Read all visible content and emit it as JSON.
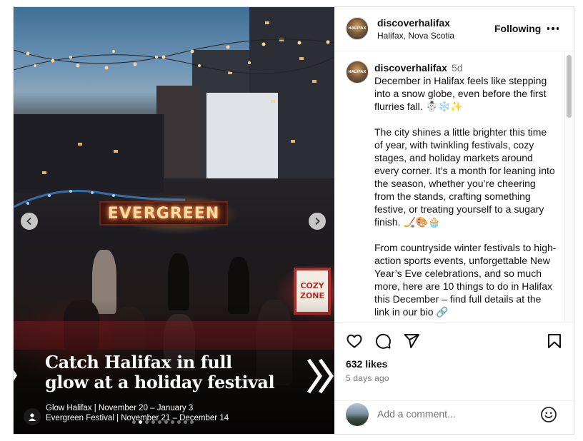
{
  "post": {
    "media": {
      "sign_text": "EVERGREEN",
      "cozy_line1": "COZY",
      "cozy_line2": "ZONE",
      "headline_line1": "Catch Halifax in full",
      "headline_line2": "glow at a holiday festival",
      "caption_line1": "Glow Halifax | November 20 – January 3",
      "caption_line2": "Evergreen Festival | November 21 – December 14",
      "carousel": {
        "total": 10,
        "active_index": 1
      }
    },
    "header": {
      "username": "discoverhalifax",
      "location": "Halifax, Nova Scotia",
      "follow_status": "Following",
      "avatar_text": "HALIFAX"
    },
    "comment": {
      "username": "discoverhalifax",
      "age": "5d",
      "paragraph1": "December in Halifax feels like stepping into a snow globe, even before the first flurries fall. ☃️❄️✨",
      "paragraph2": "The city shines a little brighter this time of year, with twinkling festivals, cozy stages, and holiday markets around every corner. It’s a month for leaning into the season, whether you’re cheering from the stands, crafting something festive, or treating yourself to a sugary finish. 🏒🎨🧁",
      "paragraph3": "From countryside winter festivals to high-action sports events, unforgettable New Year’s Eve celebrations, and so much more, here are 10 things to do in Halifax this December – find full details at the link in our bio 🔗"
    },
    "engagement": {
      "likes": "632 likes",
      "time_ago": "5 days ago"
    },
    "add_comment": {
      "placeholder": "Add a comment..."
    }
  },
  "icons": {
    "like": "heart-icon",
    "comment": "comment-bubble-icon",
    "share": "paper-plane-icon",
    "save": "bookmark-icon",
    "emoji": "smiley-icon",
    "more": "more-dots-icon",
    "prev": "chevron-left-icon",
    "next": "chevron-right-icon",
    "tag": "user-tag-icon"
  }
}
